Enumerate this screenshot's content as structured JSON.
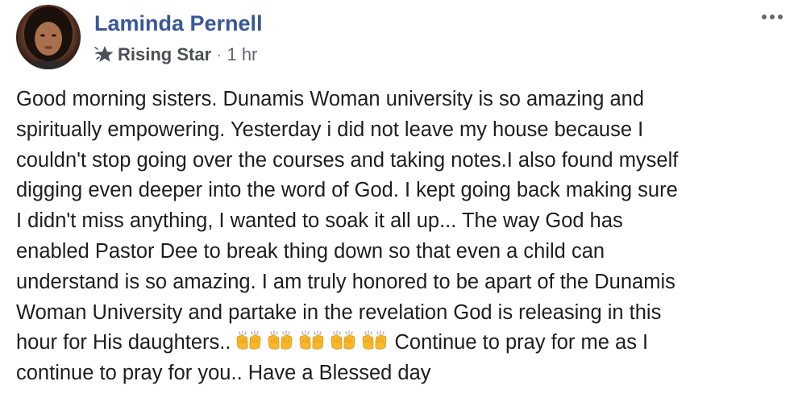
{
  "post": {
    "author": "Laminda Pernell",
    "badge": {
      "icon": "rising-star-icon",
      "label": "Rising Star"
    },
    "separator": "·",
    "timestamp": "1 hr",
    "more_icon": "more-options-icon",
    "text_before_emoji": "Good morning sisters. Dunamis Woman university is so amazing and\nspiritually empowering. Yesterday i did not leave my house because I\ncouldn't stop going over the courses and taking notes.I also found myself\ndigging even deeper into the word of God. I kept going back making sure\nI didn't miss anything, I wanted to soak it all up... The way God has\nenabled Pastor Dee to break thing down so that even a child can\nunderstand is so amazing. I am truly honored to be apart of the Dunamis\nWoman University and partake in the revelation God is releasing in this\nhour for His daughters..",
    "emoji": {
      "name": "raising-hands-emoji",
      "count": 5
    },
    "text_after_emoji": "Continue to pray for me as I\ncontinue to pray for you.. Have a Blessed day"
  },
  "colors": {
    "author": "#385898",
    "text": "#1c1e21",
    "meta": "#616770",
    "badge": "#4b4f56"
  }
}
